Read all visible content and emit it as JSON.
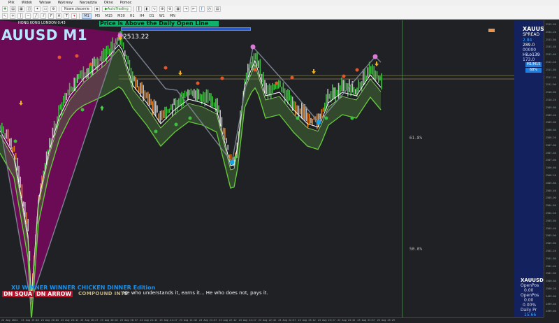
{
  "menubar": {
    "items": [
      "Plik",
      "Widok",
      "Wstaw",
      "Wykresy",
      "Narzędzia",
      "Okno",
      "Pomoc"
    ]
  },
  "toolbar": {
    "new_order_label": "Nowe zlecenie",
    "autotrading_label": "AutoTrading",
    "timeframes": [
      "M1",
      "M5",
      "M15",
      "M30",
      "H1",
      "H4",
      "D1",
      "W1",
      "MN"
    ],
    "active_timeframe": "M1"
  },
  "chart": {
    "symbol_title": "AUUSD M1",
    "session_label": "HONG KONG LONDON 0:43",
    "banner_text": "Price is Above the Daily Open Line",
    "price_tag": "2513.22",
    "fib_61": "61.8%",
    "fib_50": "50.0%",
    "edition_text": "XU WINNER WINNER CHICKEN DINNER Edition",
    "dn_square_label": "DN SQUA",
    "dn_arrow_label": "DN ARROW",
    "compound_label": "COMPOUND INTE",
    "quote_text": "He who understands it, earns it... He who does not, pays it.",
    "price_ticks": [
      "2515.40",
      "2514.20",
      "2513.80",
      "2513.40",
      "2512.60",
      "2512.20",
      "2511.80",
      "2511.40",
      "2511.00",
      "2510.60",
      "2510.20",
      "2509.80",
      "2509.40",
      "2509.00",
      "2508.60",
      "2508.20",
      "2507.80",
      "2507.40",
      "2507.00",
      "2506.60",
      "2506.20",
      "2505.80",
      "2505.40",
      "2505.00",
      "2504.60",
      "2504.20",
      "2503.80",
      "2503.40",
      "2503.00",
      "2502.60",
      "2502.20",
      "2501.80",
      "2501.40",
      "2501.00",
      "2500.60",
      "2500.20",
      "2499.80",
      "2499.40",
      "2499.00"
    ],
    "time_ticks": [
      "23 Aug 2024",
      "23 Aug 19:48",
      "23 Aug 20:04",
      "23 Aug 20:12",
      "23 Aug 20:27",
      "23 Aug 20:42",
      "23 Aug 20:57",
      "23 Aug 21:12",
      "23 Aug 21:27",
      "23 Aug 21:42",
      "23 Aug 21:57",
      "23 Aug 22:12",
      "23 Aug 22:27",
      "23 Aug 22:42",
      "23 Aug 22:57",
      "23 Aug 23:12",
      "23 Aug 23:27",
      "23 Aug 23:42",
      "23 Aug 23:57",
      "23 Aug 23:29"
    ]
  },
  "right_panel": {
    "symbol": "XAUUSD",
    "lines": [
      {
        "text": "SPREAD",
        "color": "#ffffff"
      },
      {
        "text": "2.84",
        "color": "#39a8ff"
      },
      {
        "text": "289.0",
        "color": "#ffffff"
      },
      {
        "text": "00000",
        "color": "#cfd6ff"
      },
      {
        "text": "HiLo139",
        "color": "#ffffff"
      },
      {
        "text": "173.0",
        "color": "#cfd6ff"
      }
    ],
    "box_labels": [
      "M1/M15",
      "68%"
    ],
    "bottom_symbol": "XAUUSD",
    "bottom_lines": [
      "OpenPos",
      "0.00",
      "OpenPos",
      "0.00",
      "0.00%",
      "Daily Pr",
      "15.66"
    ]
  },
  "colors": {
    "bull": "#3dbd3d",
    "bear": "#e57d1a",
    "neutral": "#bdbdbd",
    "cloud_bull": "#4a7a3a",
    "cloud_bear": "#7a4b2a",
    "purple_fill": "#6b0a55",
    "zigzag": "#7b8290"
  }
}
